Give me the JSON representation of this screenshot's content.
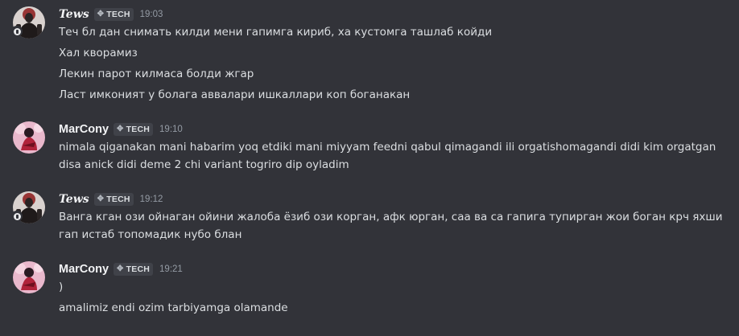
{
  "colors": {
    "background": "#323339",
    "username": "#f2f3f5",
    "text": "#dbdee1",
    "timestamp": "#949ba4",
    "tag_bg": "#404249"
  },
  "messages": [
    {
      "author": "Tews",
      "tag": "TECH",
      "tag_icon": "tech-badge-icon",
      "time": "19:03",
      "lines": [
        "Теч бл дан снимать килди мени гапимга кириб, ха кустомга ташлаб койди",
        "Хал кворамиз",
        "Лекин парот килмаса болди жгар",
        "Ласт имконият у болага аввалари ишкаллари коп боганакан"
      ]
    },
    {
      "author": "MarCony",
      "tag": "TECH",
      "tag_icon": "tech-badge-icon",
      "time": "19:10",
      "lines": [
        "nimala qiganakan mani habarim yoq etdiki mani miyyam feedni qabul qimagandi ili orgatishomagandi didi kim orgatgan",
        "disa anick didi deme 2 chi variant togriro dip oyladim"
      ]
    },
    {
      "author": "Tews",
      "tag": "TECH",
      "tag_icon": "tech-badge-icon",
      "time": "19:12",
      "lines": [
        "Ванга кган ози ойнаган ойини жалоба ёзиб ози корган, афк юрган, саа ва са гапига тупирган жои боган крч яхши",
        "гап истаб топомадик нубо блан"
      ]
    },
    {
      "author": "MarCony",
      "tag": "TECH",
      "tag_icon": "tech-badge-icon",
      "time": "19:21",
      "lines": [
        ")",
        "amalimiz  endi ozim tarbiyamga olamande"
      ]
    }
  ]
}
